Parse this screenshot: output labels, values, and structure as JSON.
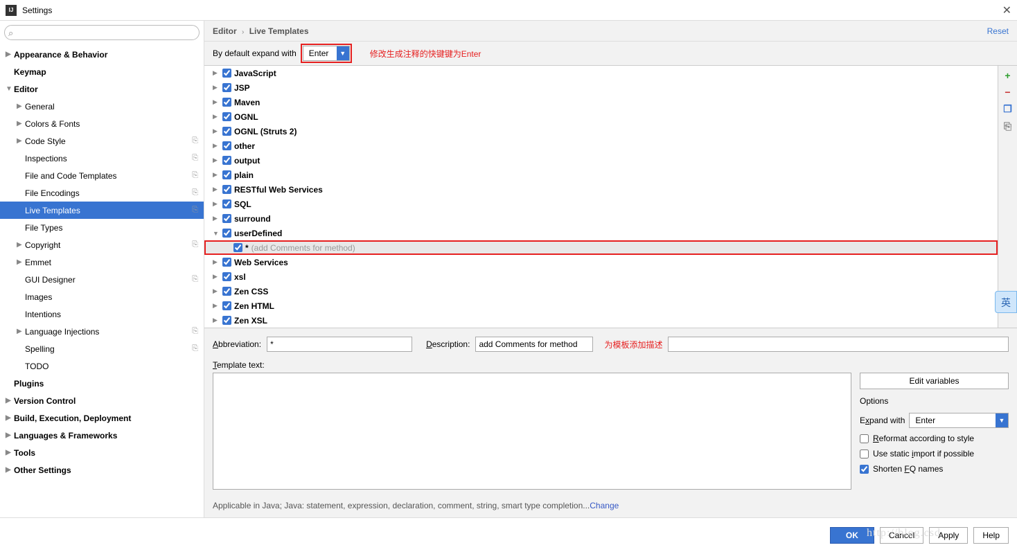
{
  "window": {
    "title": "Settings",
    "close": "✕"
  },
  "sidebar": {
    "search_placeholder": "",
    "items": [
      {
        "label": "Appearance & Behavior",
        "bold": true,
        "arrow": "▶",
        "indent": 0
      },
      {
        "label": "Keymap",
        "bold": true,
        "arrow": "",
        "indent": 0
      },
      {
        "label": "Editor",
        "bold": true,
        "arrow": "▼",
        "indent": 0
      },
      {
        "label": "General",
        "arrow": "▶",
        "indent": 1
      },
      {
        "label": "Colors & Fonts",
        "arrow": "▶",
        "indent": 1
      },
      {
        "label": "Code Style",
        "arrow": "▶",
        "indent": 1,
        "dup": true
      },
      {
        "label": "Inspections",
        "arrow": "",
        "indent": 1,
        "dup": true
      },
      {
        "label": "File and Code Templates",
        "arrow": "",
        "indent": 1,
        "dup": true
      },
      {
        "label": "File Encodings",
        "arrow": "",
        "indent": 1,
        "dup": true
      },
      {
        "label": "Live Templates",
        "arrow": "",
        "indent": 1,
        "dup": true,
        "selected": true
      },
      {
        "label": "File Types",
        "arrow": "",
        "indent": 1
      },
      {
        "label": "Copyright",
        "arrow": "▶",
        "indent": 1,
        "dup": true
      },
      {
        "label": "Emmet",
        "arrow": "▶",
        "indent": 1
      },
      {
        "label": "GUI Designer",
        "arrow": "",
        "indent": 1,
        "dup": true
      },
      {
        "label": "Images",
        "arrow": "",
        "indent": 1
      },
      {
        "label": "Intentions",
        "arrow": "",
        "indent": 1
      },
      {
        "label": "Language Injections",
        "arrow": "▶",
        "indent": 1,
        "dup": true
      },
      {
        "label": "Spelling",
        "arrow": "",
        "indent": 1,
        "dup": true
      },
      {
        "label": "TODO",
        "arrow": "",
        "indent": 1
      },
      {
        "label": "Plugins",
        "bold": true,
        "arrow": "",
        "indent": 0
      },
      {
        "label": "Version Control",
        "bold": true,
        "arrow": "▶",
        "indent": 0
      },
      {
        "label": "Build, Execution, Deployment",
        "bold": true,
        "arrow": "▶",
        "indent": 0
      },
      {
        "label": "Languages & Frameworks",
        "bold": true,
        "arrow": "▶",
        "indent": 0
      },
      {
        "label": "Tools",
        "bold": true,
        "arrow": "▶",
        "indent": 0
      },
      {
        "label": "Other Settings",
        "bold": true,
        "arrow": "▶",
        "indent": 0
      }
    ]
  },
  "crumbs": {
    "a": "Editor",
    "b": "Live Templates",
    "reset": "Reset"
  },
  "expand": {
    "label": "By default expand with",
    "value": "Enter",
    "note": "修改生成注释的快键键为Enter"
  },
  "templates": [
    {
      "label": "JavaScript",
      "arrow": "▶"
    },
    {
      "label": "JSP",
      "arrow": "▶"
    },
    {
      "label": "Maven",
      "arrow": "▶"
    },
    {
      "label": "OGNL",
      "arrow": "▶"
    },
    {
      "label": "OGNL (Struts 2)",
      "arrow": "▶"
    },
    {
      "label": "other",
      "arrow": "▶"
    },
    {
      "label": "output",
      "arrow": "▶"
    },
    {
      "label": "plain",
      "arrow": "▶"
    },
    {
      "label": "RESTful Web Services",
      "arrow": "▶"
    },
    {
      "label": "SQL",
      "arrow": "▶"
    },
    {
      "label": "surround",
      "arrow": "▶"
    },
    {
      "label": "userDefined",
      "arrow": "▼"
    },
    {
      "label": "*",
      "desc": " (add Comments for method)",
      "arrow": "",
      "child": true
    },
    {
      "label": "Web Services",
      "arrow": "▶"
    },
    {
      "label": "xsl",
      "arrow": "▶"
    },
    {
      "label": "Zen CSS",
      "arrow": "▶"
    },
    {
      "label": "Zen HTML",
      "arrow": "▶"
    },
    {
      "label": "Zen XSL",
      "arrow": "▶"
    }
  ],
  "toolbar": {
    "add": "+",
    "remove": "−",
    "copy": "❐",
    "export": "⎘"
  },
  "form": {
    "abbr_label": "Abbreviation:",
    "abbr_value": "*",
    "desc_label": "Description:",
    "desc_value": "add Comments for method",
    "desc_note": "为模板添加描述",
    "tmpl_label": "Template text:",
    "tmpl_value": ""
  },
  "right": {
    "edit_vars": "Edit variables",
    "options": "Options",
    "expand_with": "Expand with",
    "expand_value": "Enter",
    "reformat": "Reformat according to style",
    "static_import": "Use static import if possible",
    "shorten": "Shorten FQ names"
  },
  "applicable": {
    "text": "Applicable in Java; Java: statement, expression, declaration, comment, string, smart type completion...",
    "change": "Change"
  },
  "footer": {
    "ok": "OK",
    "cancel": "Cancel",
    "apply": "Apply",
    "help": "Help"
  },
  "ime": "英",
  "watermark": "http://blog.csd"
}
